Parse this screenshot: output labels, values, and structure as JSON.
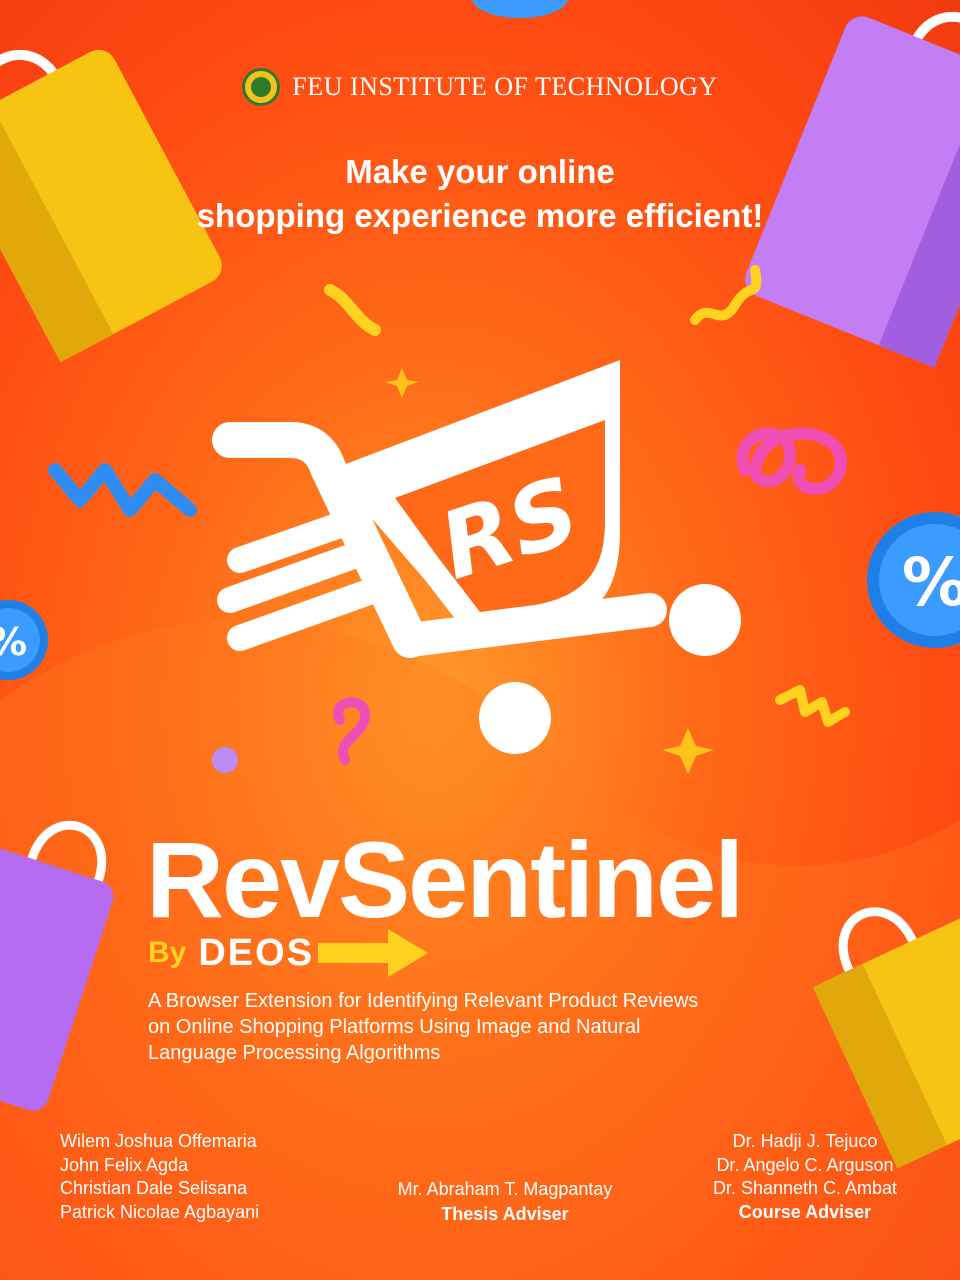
{
  "header": {
    "institution": "FEU INSTITUTE OF TECHNOLOGY",
    "seal": {
      "text": "FEU",
      "icon": "feu-seal-icon"
    }
  },
  "tagline": {
    "line1": "Make your online",
    "line2": "shopping experience more efficient!"
  },
  "logo": {
    "monogram": "RS",
    "icon": "shopping-cart-icon"
  },
  "product": {
    "name": "RevSentinel",
    "by": "By",
    "team": "DEOS"
  },
  "description": {
    "line1": "A Browser Extension for Identifying Relevant Product Reviews",
    "line2": "on Online Shopping Platforms Using Image and Natural",
    "line3": "Language Processing Algorithms"
  },
  "authors": [
    "Wilem Joshua Offemaria",
    "John Felix Agda",
    "Christian Dale Selisana",
    "Patrick Nicolae Agbayani"
  ],
  "thesis_adviser": {
    "name": "Mr. Abraham T. Magpantay",
    "role": "Thesis Adviser"
  },
  "course_advisers": {
    "names": [
      "Dr. Hadji J. Tejuco",
      "Dr. Angelo C. Arguson",
      "Dr. Shanneth C. Ambat"
    ],
    "role": "Course Adviser"
  },
  "colors": {
    "background": "#ff5a14",
    "accent_yellow": "#ffd21f",
    "text": "#ffffff",
    "seal_green": "#2d7a2d"
  }
}
